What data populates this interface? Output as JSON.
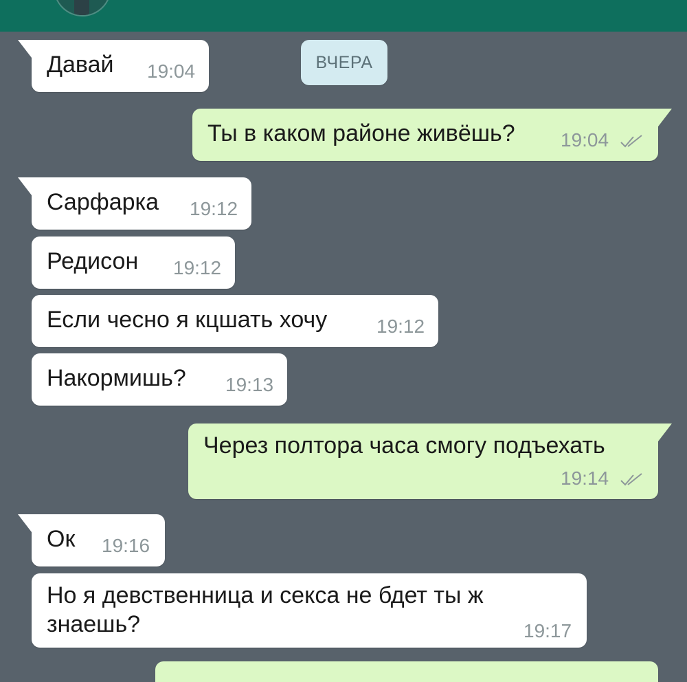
{
  "date_divider": "ВЧЕРА",
  "messages": [
    {
      "direction": "in",
      "text": "Давай",
      "time": "19:04"
    },
    {
      "direction": "out",
      "text": "Ты в каком районе живёшь?",
      "time": "19:04",
      "status": "read"
    },
    {
      "direction": "in",
      "text": "Сарфарка",
      "time": "19:12"
    },
    {
      "direction": "in",
      "text": "Редисон",
      "time": "19:12"
    },
    {
      "direction": "in",
      "text": "Если чесно я кцшать хочу",
      "time": "19:12"
    },
    {
      "direction": "in",
      "text": "Накормишь?",
      "time": "19:13"
    },
    {
      "direction": "out",
      "text": "Через полтора часа смогу подъехать",
      "time": "19:14",
      "status": "read"
    },
    {
      "direction": "in",
      "text": "Ок",
      "time": "19:16"
    },
    {
      "direction": "in",
      "text_line1": "Но я девственница и секса не бдет ты ж",
      "text_line2": "знаешь?",
      "time": "19:17"
    }
  ],
  "colors": {
    "chat_background": "#58626b",
    "header": "#0e6f5d",
    "incoming_bubble": "#ffffff",
    "outgoing_bubble": "#dcf8c5",
    "read_ticks": "#8d979a"
  },
  "icons": {
    "read_status": "double-check-icon"
  }
}
